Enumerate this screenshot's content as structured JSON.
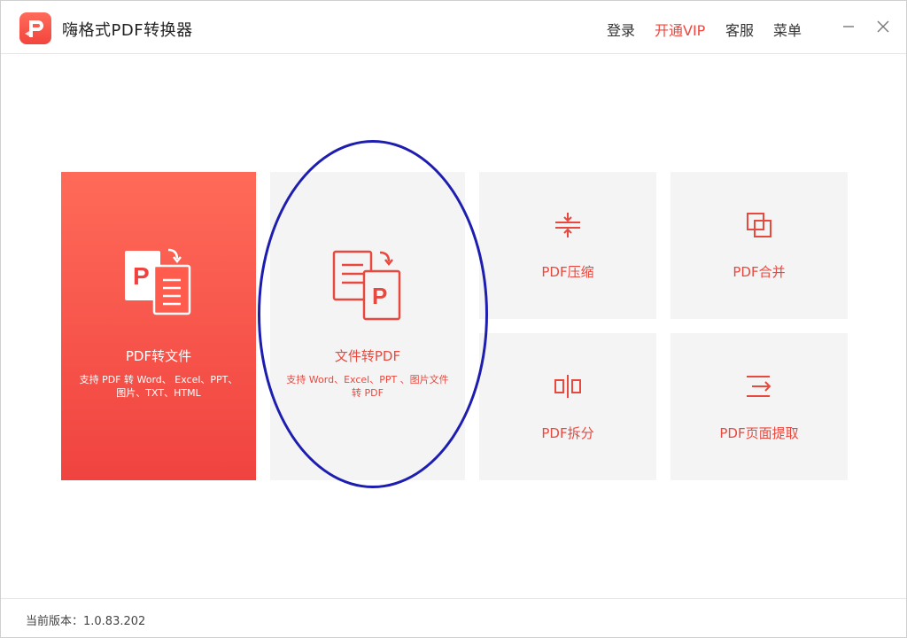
{
  "app": {
    "title": "嗨格式PDF转换器",
    "logo_icon": "app-logo-icon"
  },
  "header": {
    "login": "登录",
    "vip": "开通VIP",
    "service": "客服",
    "menu": "菜单",
    "minimize_icon": "minimize-icon",
    "close_icon": "close-icon"
  },
  "cards": {
    "pdf_to_file": {
      "label": "PDF转文件",
      "desc": "支持 PDF 转 Word、 Excel、PPT、图片、TXT、HTML",
      "icon": "pdf-to-file-icon"
    },
    "file_to_pdf": {
      "label": "文件转PDF",
      "desc": "支持 Word、Excel、PPT 、图片文件转 PDF",
      "icon": "file-to-pdf-icon"
    },
    "compress": {
      "label": "PDF压缩",
      "icon": "compress-icon"
    },
    "merge": {
      "label": "PDF合并",
      "icon": "merge-icon"
    },
    "split": {
      "label": "PDF拆分",
      "icon": "split-icon"
    },
    "extract": {
      "label": "PDF页面提取",
      "icon": "extract-icon"
    }
  },
  "footer": {
    "version": "当前版本：1.0.83.202"
  },
  "colors": {
    "accent": "#f2453d",
    "card_bg": "#f4f4f4",
    "annotation": "#1d1db0"
  }
}
